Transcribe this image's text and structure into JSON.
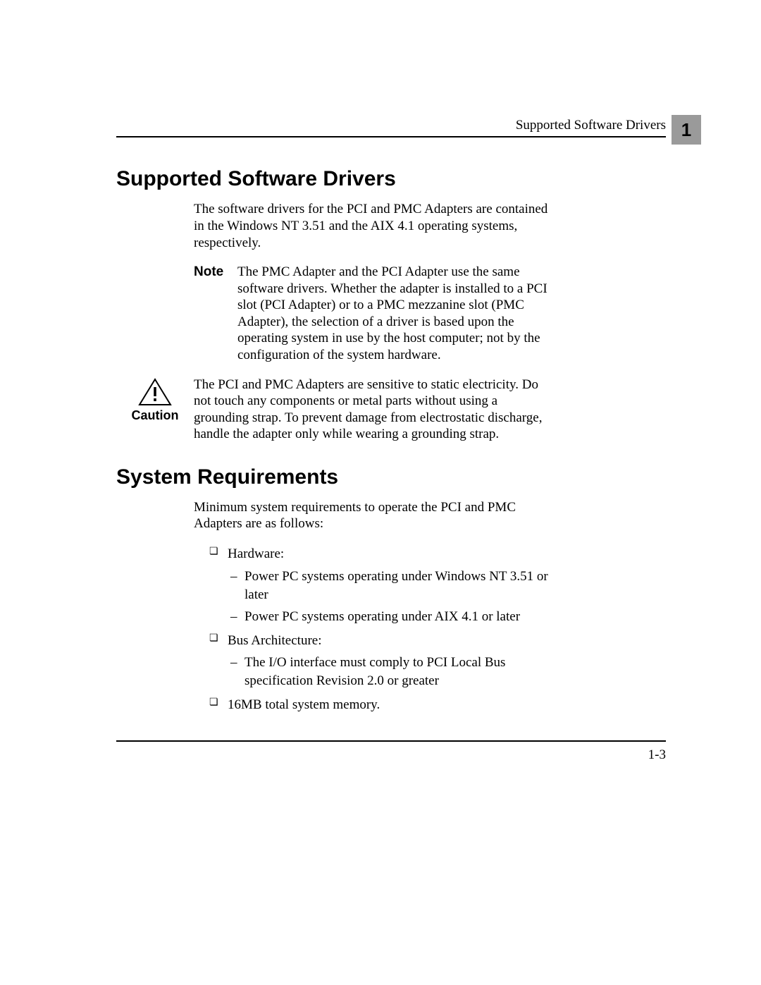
{
  "header": {
    "running_title": "Supported Software Drivers",
    "chapter_number": "1"
  },
  "section1": {
    "heading": "Supported Software Drivers",
    "intro": "The software drivers for the PCI and PMC Adapters are contained in the Windows NT 3.51 and the AIX 4.1 operating systems, respectively.",
    "note_label": "Note",
    "note_text": "The PMC Adapter and the PCI Adapter use the same software drivers. Whether the adapter is installed to a PCI slot (PCI Adapter) or to a PMC mezzanine slot (PMC Adapter), the selection of a driver is based upon the operating system in use by the host computer; not by the configuration of the system hardware.",
    "caution_label": "Caution",
    "caution_text": "The PCI and PMC Adapters are sensitive to static electricity. Do not touch any components or metal parts without using a grounding strap. To prevent damage from electrostatic discharge, handle the adapter only while wearing a grounding strap."
  },
  "section2": {
    "heading": "System Requirements",
    "intro": "Minimum system requirements to operate the PCI and PMC Adapters are as follows:",
    "items": [
      {
        "label": "Hardware:",
        "subitems": [
          "Power PC systems operating under Windows NT 3.51 or later",
          "Power PC systems operating under AIX 4.1 or later"
        ]
      },
      {
        "label": "Bus Architecture:",
        "subitems": [
          "The I/O interface must comply to PCI Local Bus specification Revision 2.0 or greater"
        ]
      },
      {
        "label": "16MB total system memory.",
        "subitems": []
      }
    ]
  },
  "footer": {
    "page_number": "1-3"
  }
}
